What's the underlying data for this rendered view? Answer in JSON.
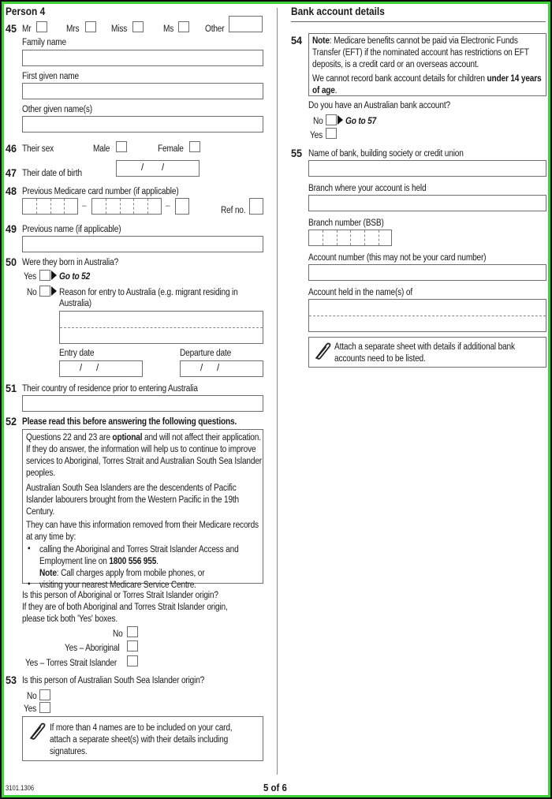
{
  "left": {
    "section_title": "Person 4",
    "q45": {
      "number": "45",
      "titles": [
        "Mr",
        "Mrs",
        "Miss",
        "Ms",
        "Other"
      ],
      "family_name_label": "Family name",
      "first_given_name_label": "First given name",
      "other_given_names_label": "Other given name(s)"
    },
    "q46": {
      "number": "46",
      "label": "Their sex",
      "options": [
        "Male",
        "Female"
      ]
    },
    "q47": {
      "number": "47",
      "label": "Their date of birth",
      "date_separator": "/"
    },
    "q48": {
      "number": "48",
      "label": "Previous Medicare card number (if applicable)",
      "dash": "–",
      "ref_label": "Ref no."
    },
    "q49": {
      "number": "49",
      "label": "Previous name (if applicable)"
    },
    "q50": {
      "number": "50",
      "label": "Were they born in Australia?",
      "yes_label": "Yes",
      "yes_goto": "Go to 52",
      "no_label": "No",
      "no_reason_line1": "Reason for entry to Australia (e.g. migrant residing in",
      "no_reason_line2": "Australia)",
      "entry_date_label": "Entry date",
      "departure_date_label": "Departure date",
      "date_separator": "/"
    },
    "q51": {
      "number": "51",
      "label": "Their country of residence prior to entering Australia"
    },
    "q52": {
      "number": "52",
      "label": "Please read this before answering the following questions.",
      "info_p1_pre": "Questions 22 and 23 are ",
      "info_p1_bold": "optional",
      "info_p1_post": " and will not affect their application. If they do answer, the information will help us to continue to improve services to Aboriginal, Torres Strait and Australian South Sea Islander peoples.",
      "info_p2": "Australian South Sea Islanders are the descendents of Pacific Islander labourers brought from the Western Pacific in the 19th Century.",
      "info_p3": "They can have this information removed from their Medicare records at any time by:",
      "bullet1_pre": "calling the Aboriginal and Torres Strait Islander Access and Employment line on ",
      "bullet1_phone": "1800 556 955",
      "bullet1_post": ".",
      "bullet1_note_label": "Note",
      "bullet1_note_text": ": Call charges apply from mobile phones, or",
      "bullet2": "visiting your nearest Medicare Service Centre.",
      "bullet_glyph": "•",
      "origin_q_line1": "Is this person of Aboriginal or Torres Strait Islander origin?",
      "origin_q_line2": "If they are of both Aboriginal and Torres Strait Islander origin,",
      "origin_q_line3": "please tick both 'Yes' boxes.",
      "origin_options": [
        "No",
        "Yes – Aboriginal",
        "Yes – Torres Strait Islander"
      ]
    },
    "q53": {
      "number": "53",
      "label": "Is this person of Australian South Sea Islander origin?",
      "options": [
        "No",
        "Yes"
      ],
      "attach_note_line1": "If more than 4 names are to be included on your card,",
      "attach_note_line2": "attach a separate sheet(s) with their details including",
      "attach_note_line3": "signatures."
    }
  },
  "right": {
    "section_title": "Bank account details",
    "q54": {
      "number": "54",
      "note_label": "Note",
      "note_text": ": Medicare benefits cannot be paid via Electronic Funds Transfer (EFT) if the nominated account has restrictions on EFT deposits, is a credit card or an overseas account.",
      "children_pre": "We cannot record bank account details for children ",
      "children_bold": "under 14 years of age",
      "children_post": ".",
      "question": "Do you have an Australian bank account?",
      "no_label": "No",
      "no_goto": "Go to 57",
      "yes_label": "Yes"
    },
    "q55": {
      "number": "55",
      "bank_name_label": "Name of bank, building society or credit union",
      "branch_label": "Branch where your account is held",
      "bsb_label": "Branch number (BSB)",
      "account_number_label": "Account number (this may not be your card number)",
      "account_name_label": "Account held in the name(s) of",
      "attach_note_line1": "Attach a separate sheet with details if additional bank",
      "attach_note_line2": "accounts need to be listed."
    }
  },
  "footer": {
    "form_code": "3101.1306",
    "page_indicator": "5 of 6"
  },
  "colors": {
    "frame_green": "#3fd13a",
    "field_border": "#6e6e6e"
  }
}
